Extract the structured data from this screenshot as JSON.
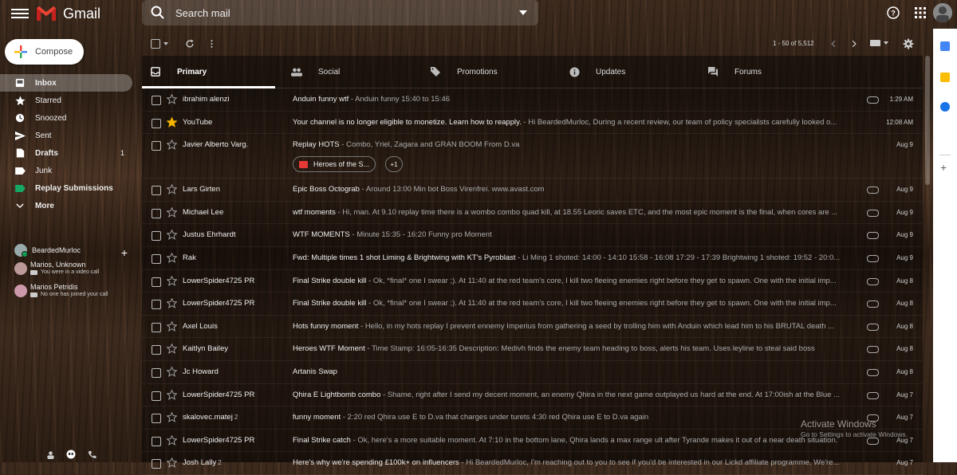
{
  "app": {
    "name": "Gmail"
  },
  "search": {
    "placeholder": "Search mail"
  },
  "compose": {
    "label": "Compose"
  },
  "sidebar": {
    "items": [
      {
        "label": "Inbox",
        "count": "",
        "icon": "inbox-icon",
        "active": true
      },
      {
        "label": "Starred",
        "count": "",
        "icon": "star-icon"
      },
      {
        "label": "Snoozed",
        "count": "",
        "icon": "clock-icon"
      },
      {
        "label": "Sent",
        "count": "",
        "icon": "send-icon"
      },
      {
        "label": "Drafts",
        "count": "1",
        "icon": "draft-icon",
        "bold": true
      },
      {
        "label": "Junk",
        "count": "",
        "icon": "label-icon"
      },
      {
        "label": "Replay Submissions",
        "count": "",
        "icon": "label-green-icon"
      },
      {
        "label": "More",
        "count": "",
        "icon": "chevron-down-icon"
      }
    ]
  },
  "hangouts": {
    "user": "BeardedMurloc",
    "contacts": [
      {
        "name": "Marios, Unknown",
        "status": "You were in a video call"
      },
      {
        "name": "Marios Petridis",
        "status": "No one has joined your call"
      }
    ]
  },
  "toolbar": {
    "pager": "1 - 50 of 5,512"
  },
  "tabs": [
    {
      "label": "Primary",
      "icon": "inbox-icon",
      "active": true
    },
    {
      "label": "Social",
      "icon": "people-icon"
    },
    {
      "label": "Promotions",
      "icon": "tag-icon"
    },
    {
      "label": "Updates",
      "icon": "info-icon"
    },
    {
      "label": "Forums",
      "icon": "forum-icon"
    }
  ],
  "emails": [
    {
      "sender": "ibrahim alenzi",
      "count": "",
      "subject": "Anduin funny wtf",
      "snippet": " - Anduin funny 15:40 to 15:46",
      "date": "1:29 AM",
      "attachment": true,
      "starred": false
    },
    {
      "sender": "YouTube",
      "count": "",
      "subject": "Your channel is no longer eligible to monetize. Learn how to reapply.",
      "snippet": " - Hi BeardedMurloc, During a recent review, our team of policy specialists carefully looked o...",
      "date": "12:08 AM",
      "attachment": false,
      "starred": true
    },
    {
      "sender": "Javier Alberto Varg.",
      "count": "",
      "subject": "Replay HOTS",
      "snippet": " - Combo, Yriel, Zagara and GRAN BOOM From D.va",
      "date": "Aug 9",
      "attachment": false,
      "starred": false,
      "chip": "Heroes of the S...",
      "chip_more": "+1"
    },
    {
      "sender": "Lars Girten",
      "count": "",
      "subject": "Epic Boss Octograb",
      "snippet": " - Around 13:00 Min bot Boss Virenfrei. www.avast.com",
      "date": "Aug 9",
      "attachment": true,
      "starred": false
    },
    {
      "sender": "Michael Lee",
      "count": "",
      "subject": "wtf moments",
      "snippet": " - Hi, man. At 9.10 replay time there is a wombo combo quad kill, at 18.55 Leoric saves ETC, and the most epic moment is the final, when cores are ...",
      "date": "Aug 9",
      "attachment": true,
      "starred": false
    },
    {
      "sender": "Justus Ehrhardt",
      "count": "",
      "subject": "WTF MOMENTS",
      "snippet": " - Minute 15:35 - 16:20 Funny pro Moment",
      "date": "Aug 9",
      "attachment": true,
      "starred": false
    },
    {
      "sender": "Rak",
      "count": "",
      "subject": "Fwd: Multiple times 1 shot Liming & Brightwing with KT's Pyroblast",
      "snippet": " - Li Ming 1 shoted: 14:00 - 14:10 15:58 - 16:08 17:29 - 17:39 Brightwing 1 shoted: 19:52 - 20:0...",
      "date": "Aug 9",
      "attachment": true,
      "starred": false
    },
    {
      "sender": "LowerSpider4725 PR",
      "count": "",
      "subject": "Final Strike double kill",
      "snippet": " - Ok, *final* one I swear ;). At 11:40 at the red team's core, I kill two fleeing enemies right before they get to spawn. One with the initial imp...",
      "date": "Aug 8",
      "attachment": true,
      "starred": false
    },
    {
      "sender": "LowerSpider4725 PR",
      "count": "",
      "subject": "Final Strike double kill",
      "snippet": " - Ok, *final* one I swear ;). At 11:40 at the red team's core, I kill two fleeing enemies right before they get to spawn. One with the initial imp...",
      "date": "Aug 8",
      "attachment": true,
      "starred": false
    },
    {
      "sender": "Axel Louis",
      "count": "",
      "subject": "Hots funny moment",
      "snippet": " - Hello, in my hots replay I prevent ennemy Imperius from gathering a seed by trolling him with Anduin which lead him to his BRUTAL death ...",
      "date": "Aug 8",
      "attachment": true,
      "starred": false
    },
    {
      "sender": "Kaitlyn Bailey",
      "count": "",
      "subject": "Heroes WTF Moment",
      "snippet": " - Time Stamp: 16:05-16:35 Description: Medivh finds the enemy team heading to boss, alerts his team. Uses leyline to steal said boss",
      "date": "Aug 8",
      "attachment": true,
      "starred": false
    },
    {
      "sender": "Jc Howard",
      "count": "",
      "subject": "Artanis Swap",
      "snippet": "",
      "date": "Aug 8",
      "attachment": true,
      "starred": false
    },
    {
      "sender": "LowerSpider4725 PR",
      "count": "",
      "subject": "Qhira E Lightbomb combo",
      "snippet": " - Shame, right after I send my decent moment, an enemy Qhira in the next game outplayed us hard at the end. At 17:00ish at the Blue ...",
      "date": "Aug 7",
      "attachment": true,
      "starred": false
    },
    {
      "sender": "skalovec.matej",
      "count": "2",
      "subject": "funny moment",
      "snippet": " - 2:20 red Qhira use E to D.va that charges under turets 4:30 red Qhira use E to D.va again",
      "date": "Aug 7",
      "attachment": true,
      "starred": false
    },
    {
      "sender": "LowerSpider4725 PR",
      "count": "",
      "subject": "Final Strike catch",
      "snippet": " - Ok, here's a more suitable moment. At 7:10 in the bottom lane, Qhira lands a max range ult after Tyrande makes it out of a near death situation.",
      "date": "Aug 7",
      "attachment": true,
      "starred": false
    },
    {
      "sender": "Josh Lally",
      "count": "2",
      "subject": "Here's why we're spending £100k+ on influencers",
      "snippet": " - Hi BeardedMurloc, I'm reaching out to you to see if you'd be interested in our Lickd affiliate programme. We're...",
      "date": "Aug 7",
      "attachment": false,
      "starred": false
    }
  ],
  "watermark": {
    "line1": "Activate Windows",
    "line2": "Go to Settings to activate Windows."
  },
  "colors": {
    "accent_red": "#ea4335",
    "star_gold": "#f4b400"
  }
}
